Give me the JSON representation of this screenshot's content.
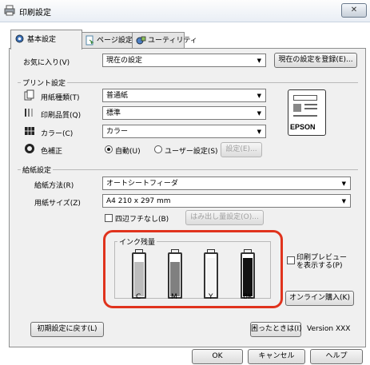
{
  "window": {
    "title": "印刷設定",
    "close_label": "✕"
  },
  "tabs": [
    {
      "label": "基本設定"
    },
    {
      "label": "ページ設定"
    },
    {
      "label": "ユーティリティ"
    }
  ],
  "favorites": {
    "label": "お気に入り(V)",
    "value": "現在の設定",
    "register_button": "現在の設定を登録(E)..."
  },
  "print_settings": {
    "group_label": "プリント設定",
    "paper_type": {
      "label": "用紙種類(T)",
      "value": "普通紙"
    },
    "quality": {
      "label": "印刷品質(Q)",
      "value": "標準"
    },
    "color": {
      "label": "カラー(C)",
      "value": "カラー"
    },
    "color_correction": {
      "label": "色補正",
      "auto": "自動(U)",
      "user": "ユーザー設定(S)",
      "settings_button": "設定(E)..."
    }
  },
  "paper_settings": {
    "group_label": "給紙設定",
    "source": {
      "label": "給紙方法(R)",
      "value": "オートシートフィーダ"
    },
    "size": {
      "label": "用紙サイズ(Z)",
      "value": "A4 210 x 297 mm"
    },
    "borderless": {
      "label": "四辺フチなし(B)"
    },
    "overflow_button": "はみ出し量設定(O)..."
  },
  "ink": {
    "group_label": "インク残量",
    "cartridges": [
      {
        "name": "C",
        "level": 0.85,
        "color": "#bdbdbd"
      },
      {
        "name": "M",
        "level": 0.85,
        "color": "#808080"
      },
      {
        "name": "Y",
        "level": 0.95,
        "color": "#f4f4f4"
      },
      {
        "name": "BK",
        "level": 0.95,
        "color": "#111111"
      }
    ]
  },
  "preview": {
    "label": "印刷プレビューを表示する(P)"
  },
  "online_purchase_button": "オンライン購入(K)",
  "reset_button": "初期設定に戻す(L)",
  "help_when_stuck_button": "困ったときは(I)",
  "version": "Version XXX",
  "footer": {
    "ok": "OK",
    "cancel": "キャンセル",
    "help": "ヘルプ"
  },
  "brand": {
    "epson": "EPSON"
  },
  "colors": {
    "highlight": "#e0331d",
    "tab_active": "#f0f0f0"
  }
}
